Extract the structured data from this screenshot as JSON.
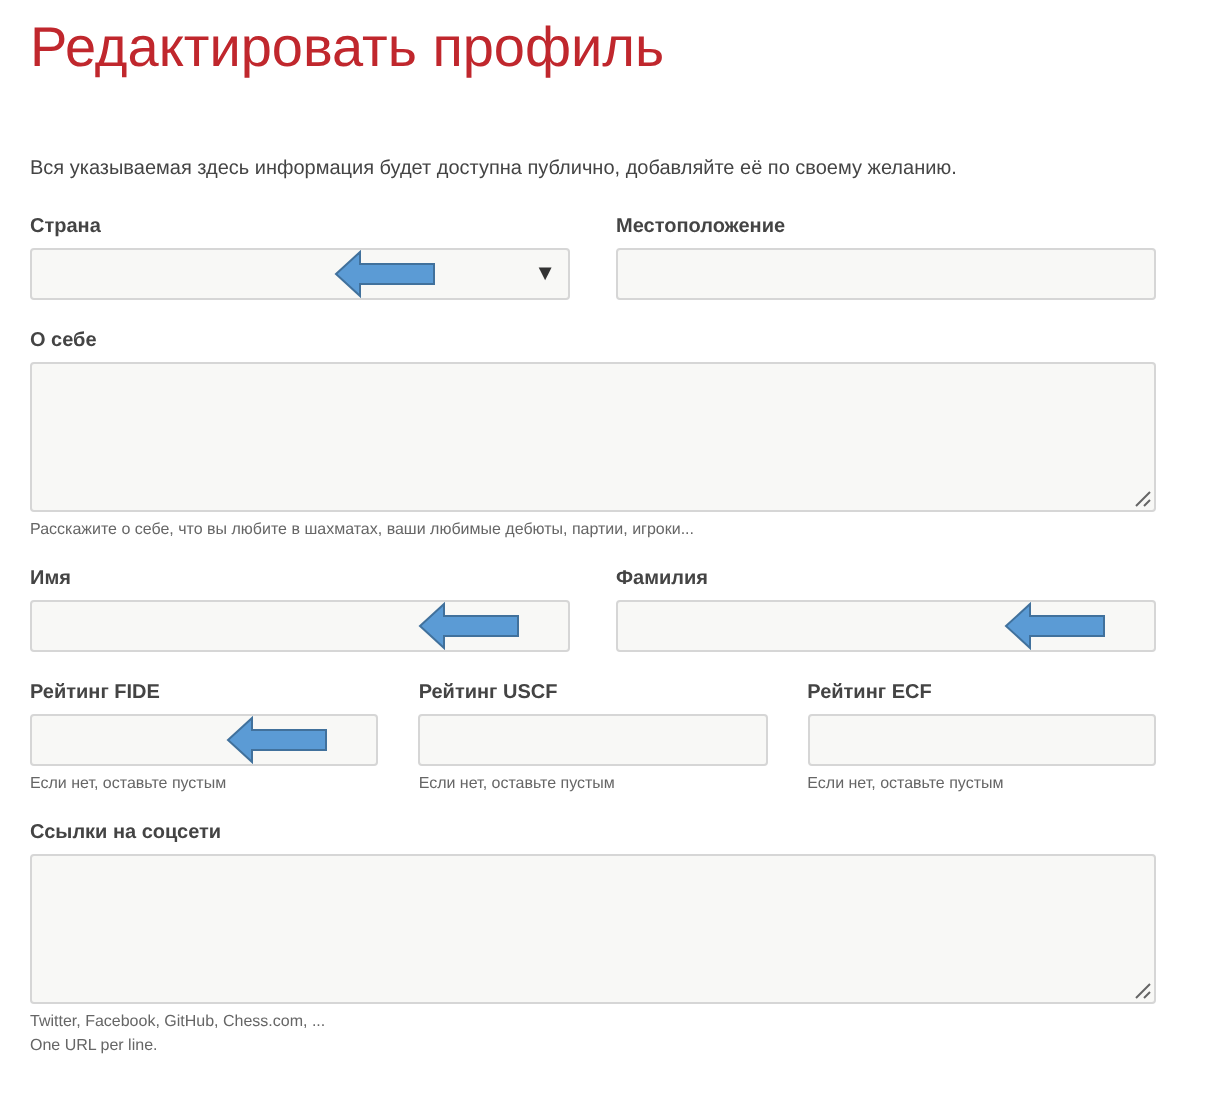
{
  "title": "Редактировать профиль",
  "intro": "Вся указываемая здесь информация будет доступна публично, добавляйте её по своему желанию.",
  "rows": [
    {
      "fields": [
        {
          "label": "Страна",
          "kind": "select",
          "caret": "▼",
          "arrow": true
        },
        {
          "label": "Местоположение",
          "kind": "input",
          "arrow": false
        }
      ]
    },
    {
      "fields": [
        {
          "label": "О себе",
          "kind": "textarea",
          "arrow": false,
          "hints": [
            "Расскажите о себе, что вы любите в шахматах, ваши любимые дебюты, партии, игроки..."
          ]
        }
      ]
    },
    {
      "fields": [
        {
          "label": "Имя",
          "kind": "input",
          "arrow": true
        },
        {
          "label": "Фамилия",
          "kind": "input",
          "arrow": true
        }
      ]
    },
    {
      "fields": [
        {
          "label": "Рейтинг FIDE",
          "kind": "input",
          "arrow": true,
          "hints": [
            "Если нет, оставьте пустым"
          ]
        },
        {
          "label": "Рейтинг USCF",
          "kind": "input",
          "arrow": false,
          "hints": [
            "Если нет, оставьте пустым"
          ]
        },
        {
          "label": "Рейтинг ECF",
          "kind": "input",
          "arrow": false,
          "hints": [
            "Если нет, оставьте пустым"
          ]
        }
      ]
    },
    {
      "fields": [
        {
          "label": "Ссылки на соцсети",
          "kind": "textarea",
          "arrow": false,
          "hints": [
            "Twitter, Facebook, GitHub, Chess.com, ...",
            "One URL per line."
          ]
        }
      ]
    }
  ]
}
